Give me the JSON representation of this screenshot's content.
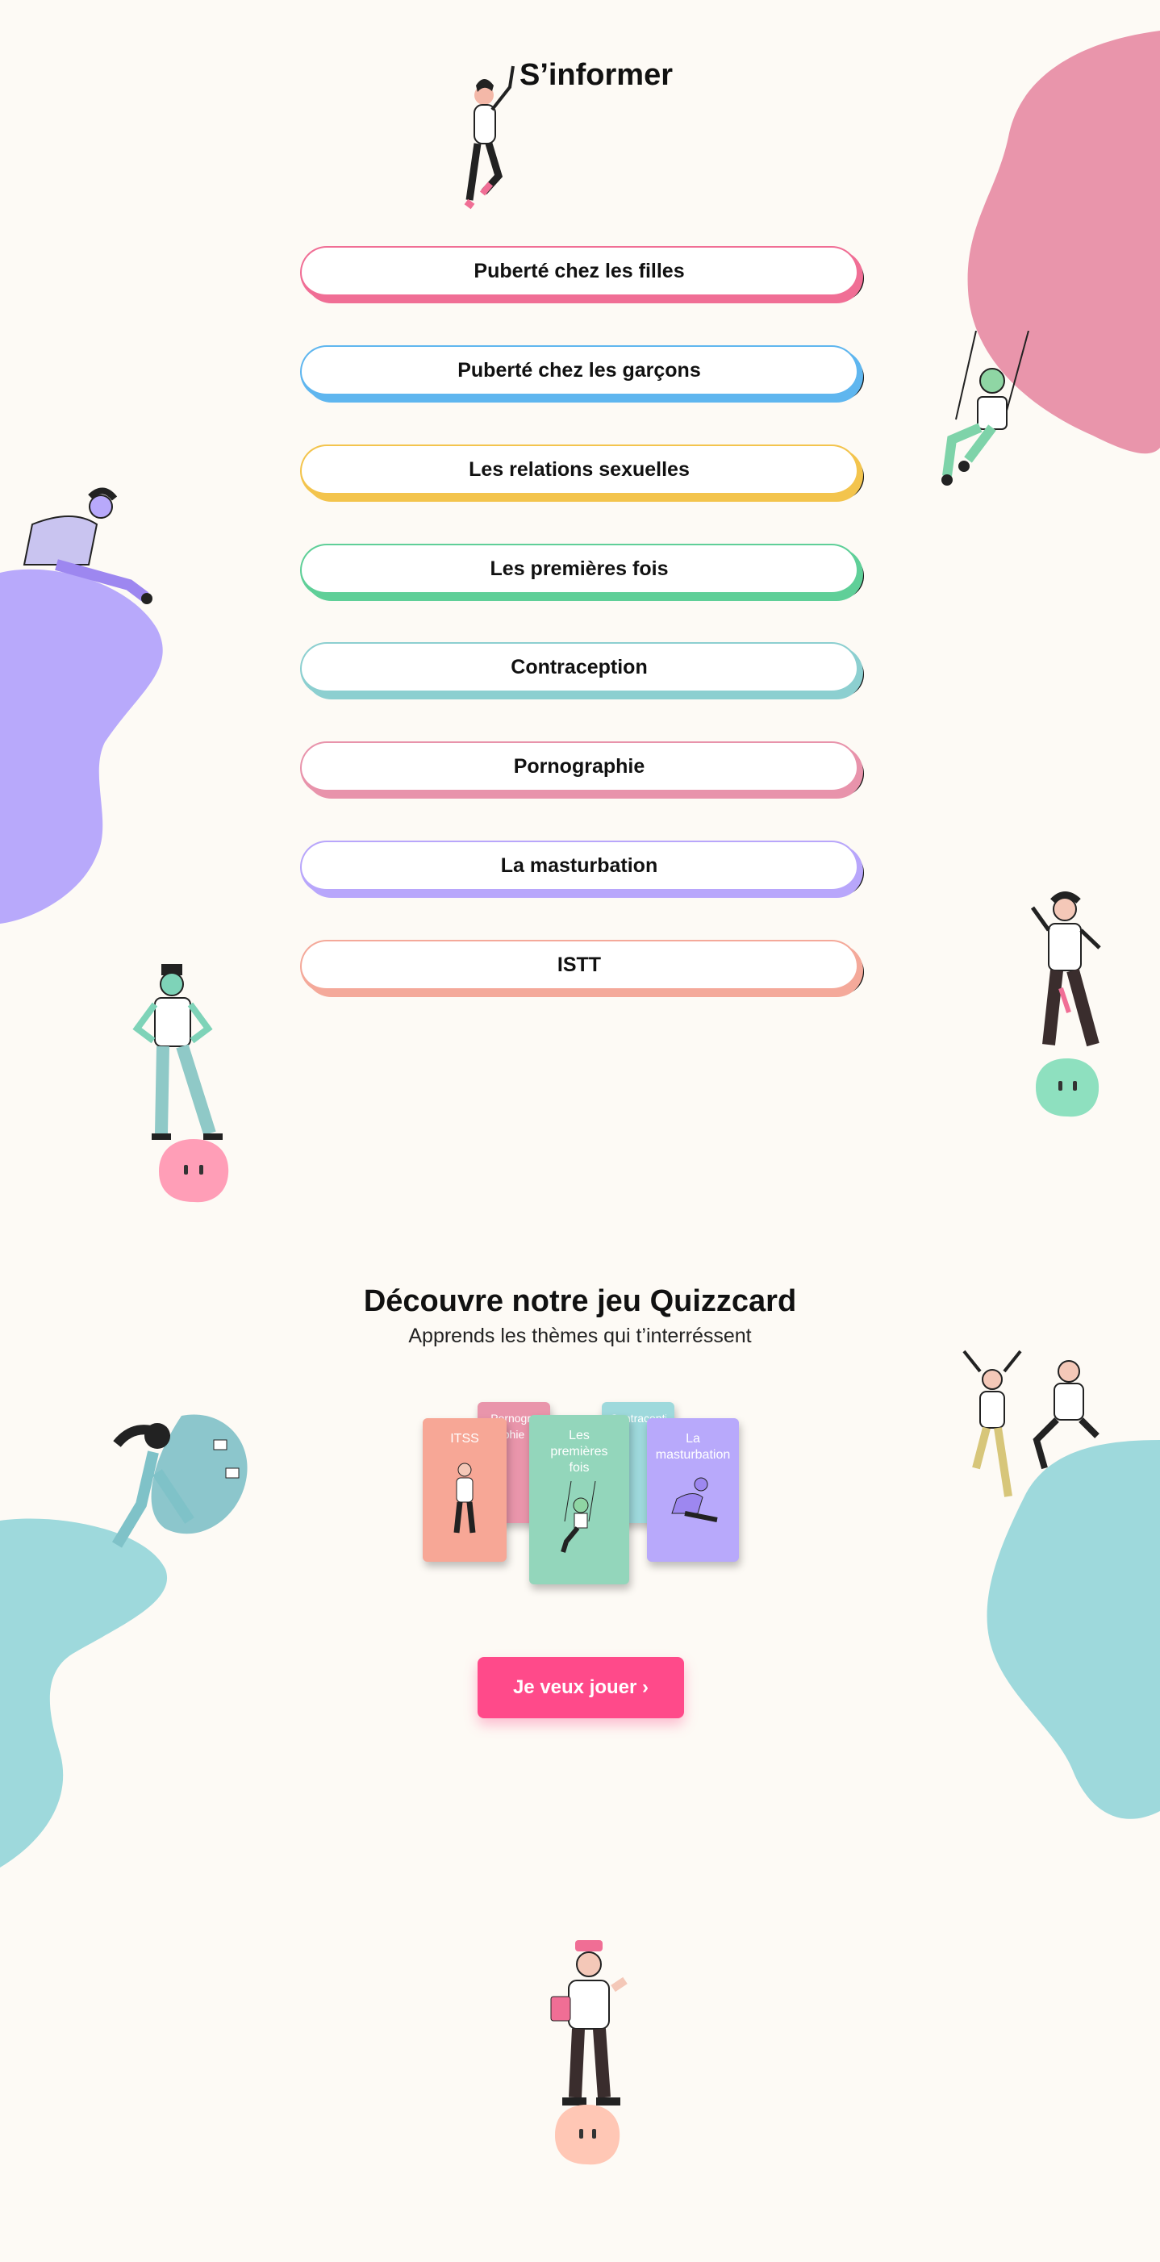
{
  "info_section": {
    "title": "S’informer",
    "buttons": [
      {
        "label": "Puberté chez les filles",
        "color": "#f06e95"
      },
      {
        "label": "Puberté chez les garçons",
        "color": "#5fb6ef"
      },
      {
        "label": "Les relations sexuelles",
        "color": "#f3c44d"
      },
      {
        "label": "Les premières fois",
        "color": "#5fcf98"
      },
      {
        "label": "Contraception",
        "color": "#8ccfd0"
      },
      {
        "label": "Pornographie",
        "color": "#e893ab"
      },
      {
        "label": "La masturbation",
        "color": "#b8a6fb"
      },
      {
        "label": "ISTT",
        "color": "#f4a99a"
      }
    ]
  },
  "quiz_section": {
    "title": "Découvre notre jeu Quizzcard",
    "subtitle": "Apprends les thèmes qui t’interréssent",
    "cards": {
      "back_left": "Pornographie",
      "back_right": "Contraception",
      "itss": "ITSS",
      "premieres": "Les premières fois",
      "masturbation": "La masturbation"
    },
    "cta_label": "Je veux jouer ›"
  },
  "colors": {
    "background": "#fdfaf5",
    "pink_blob": "#e995ab",
    "purple_blob": "#b8a9fb",
    "teal_blob": "#9ed9dc",
    "cta": "#ff4a8a"
  }
}
